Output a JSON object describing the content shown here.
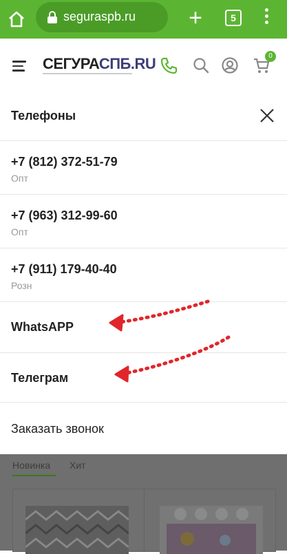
{
  "browser": {
    "url": "seguraspb.ru",
    "tab_count": "5"
  },
  "header": {
    "logo_main": "СЕГУРА",
    "logo_accent": "СПБ.RU",
    "cart_count": "0"
  },
  "panel": {
    "title": "Телефоны",
    "phones": [
      {
        "number": "+7 (812) 372-51-79",
        "label": "Опт"
      },
      {
        "number": "+7 (963) 312-99-60",
        "label": "Опт"
      },
      {
        "number": "+7 (911) 179-40-40",
        "label": "Розн"
      }
    ],
    "whatsapp": "WhatsAPP",
    "telegram": "Телеграм",
    "callback": "Заказать звонок"
  },
  "background": {
    "tabs": [
      "Новинка",
      "Хит"
    ]
  },
  "colors": {
    "brand_green": "#5cb532",
    "arrow_red": "#e0262a"
  }
}
